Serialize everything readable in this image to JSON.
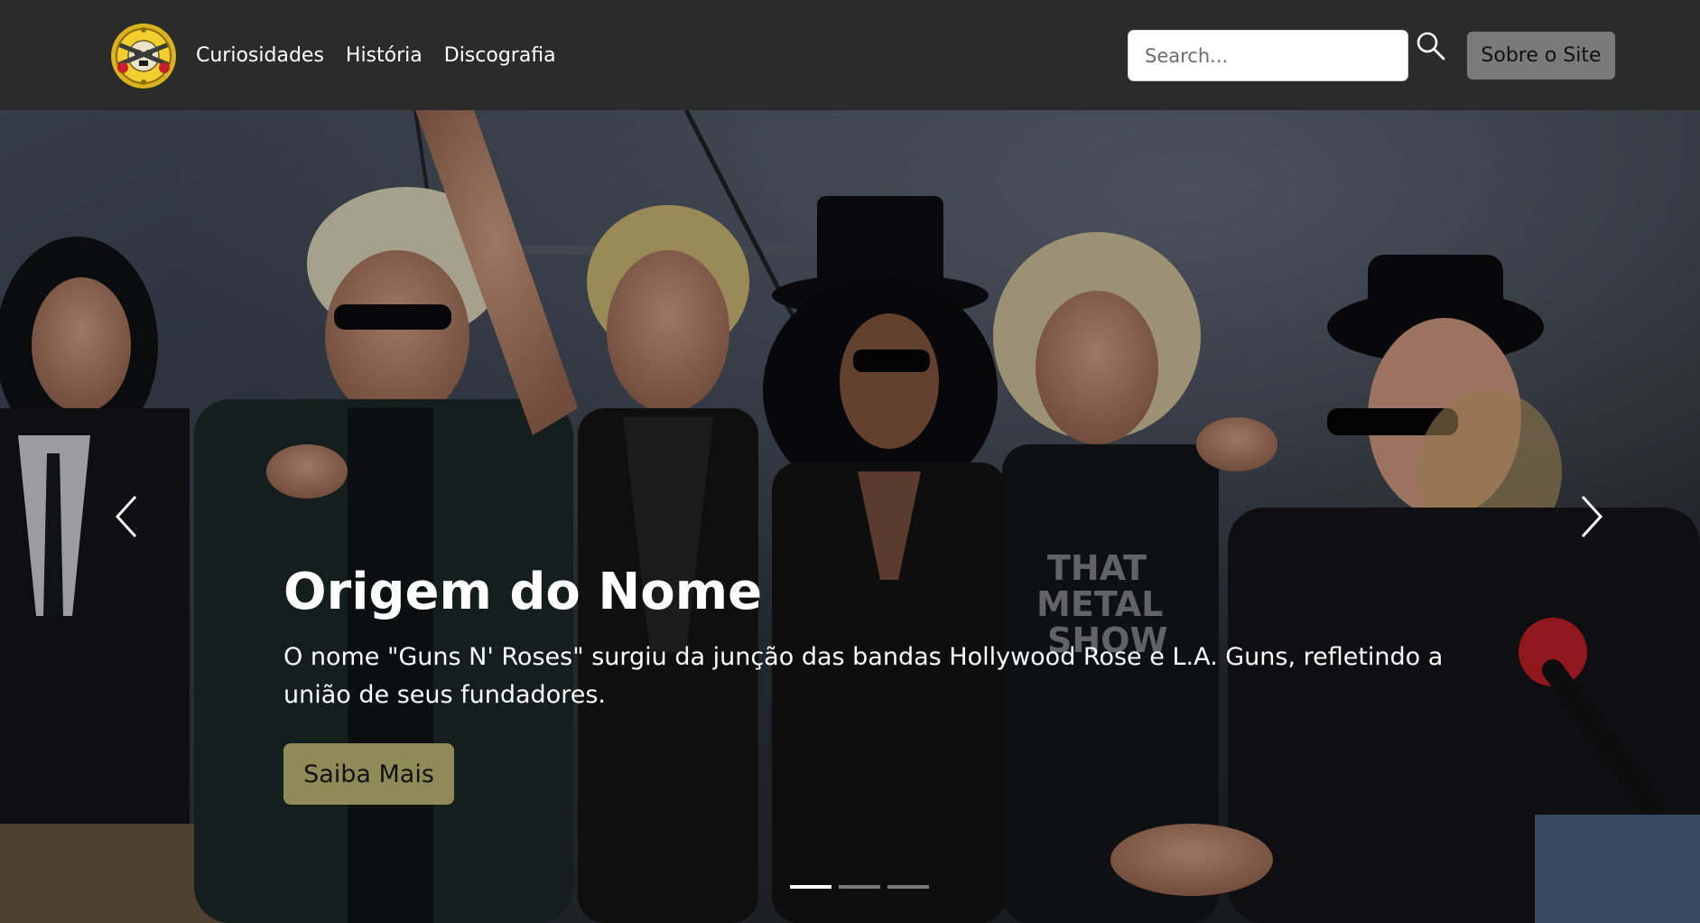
{
  "navbar": {
    "logo_alt": "Guns N' Roses logo",
    "links": [
      "Curiosidades",
      "História",
      "Discografia"
    ],
    "search": {
      "placeholder": "Search...",
      "value": ""
    },
    "about_label": "Sobre o Site"
  },
  "hero": {
    "slide": {
      "title": "Origem do Nome",
      "text": "O nome \"Guns N' Roses\" surgiu da junção das bandas Hollywood Rose e L.A. Guns, refletindo a união de seus fundadores.",
      "button_label": "Saiba Mais"
    },
    "slide_count": 3,
    "active_slide": 1
  },
  "colors": {
    "navbar_bg": "#2b2b2c",
    "about_button_bg": "#7a7a7b",
    "more_button_bg": "#8f8b58"
  }
}
